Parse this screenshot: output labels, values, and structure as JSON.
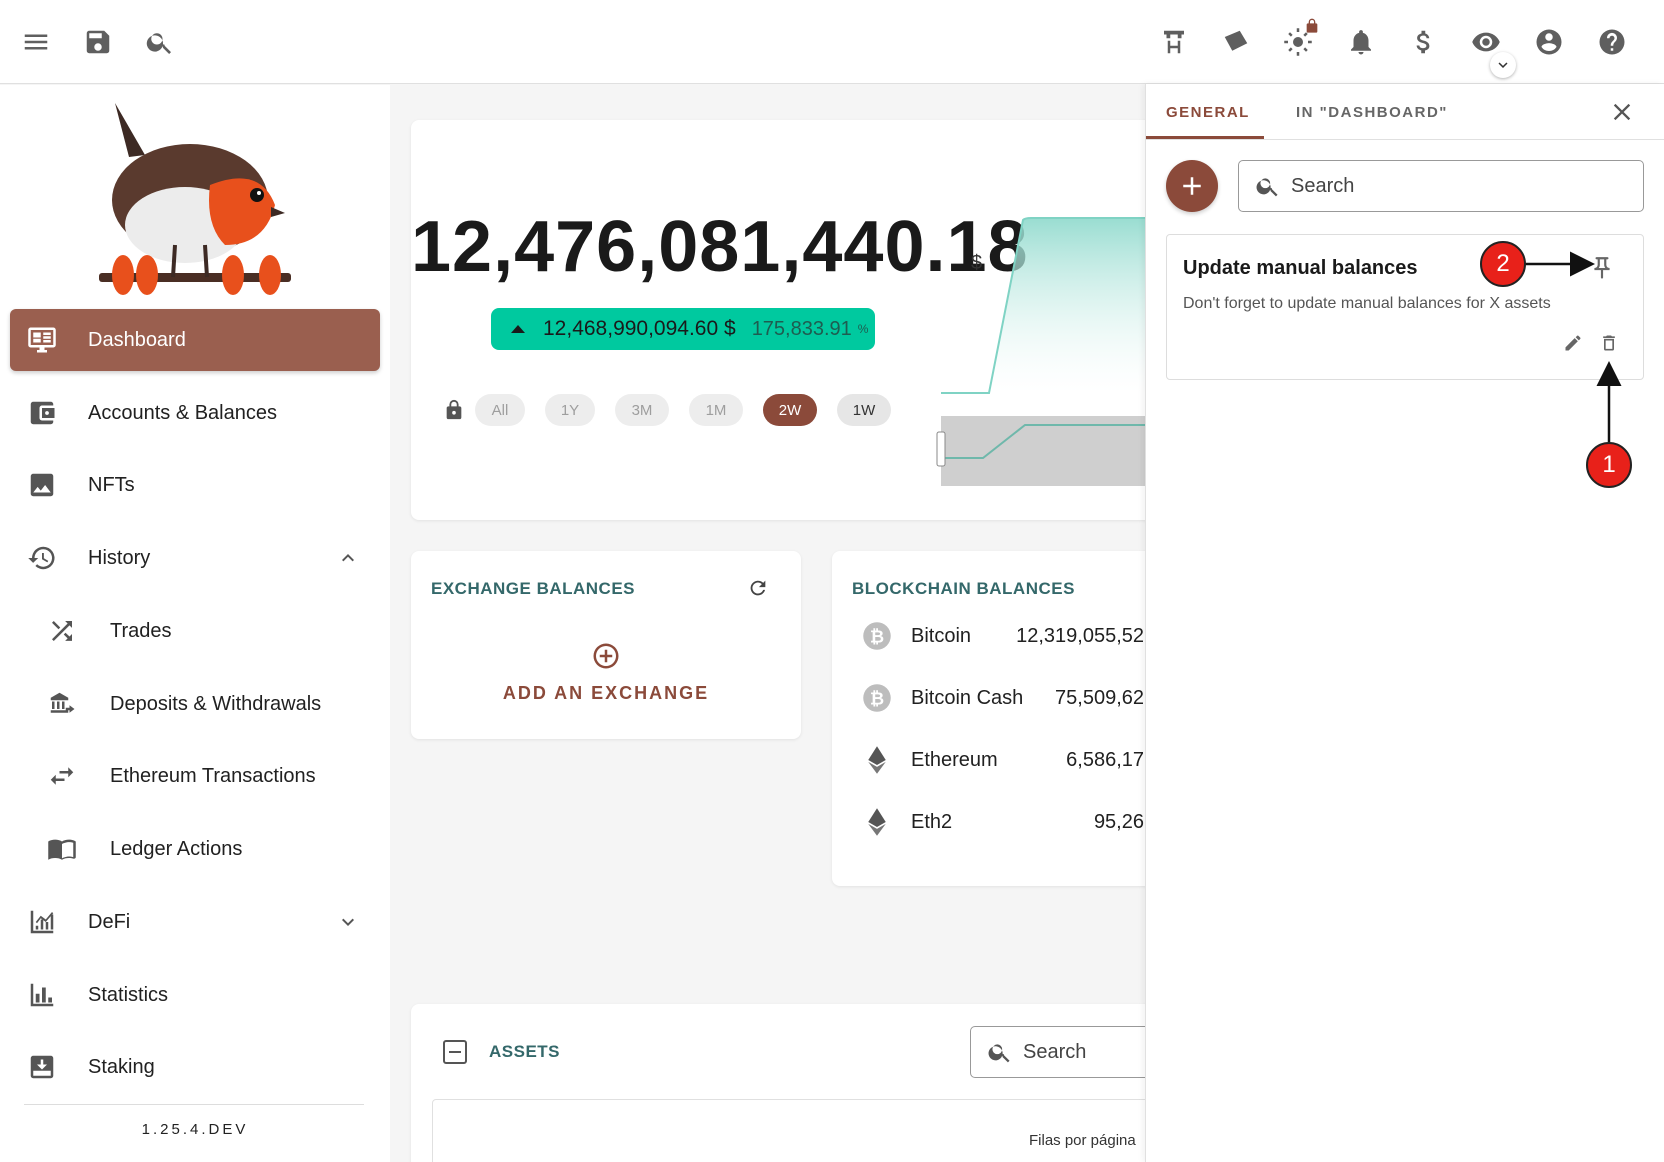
{
  "topbar": {
    "icons": [
      "menu-icon",
      "save-icon",
      "search-icon",
      "node-icon",
      "sync-icon",
      "theme-icon",
      "notification-icon",
      "currency-icon",
      "privacy-icon",
      "account-icon",
      "help-icon"
    ]
  },
  "sidebar": {
    "items": [
      {
        "label": "Dashboard",
        "icon": "dashboard-icon",
        "active": true
      },
      {
        "label": "Accounts & Balances",
        "icon": "wallet-icon"
      },
      {
        "label": "NFTs",
        "icon": "image-icon"
      },
      {
        "label": "History",
        "icon": "history-icon",
        "expanded": true
      },
      {
        "label": "Trades",
        "icon": "shuffle-icon"
      },
      {
        "label": "Deposits & Withdrawals",
        "icon": "bank-transfer-icon"
      },
      {
        "label": "Ethereum Transactions",
        "icon": "swap-icon"
      },
      {
        "label": "Ledger Actions",
        "icon": "book-icon"
      },
      {
        "label": "DeFi",
        "icon": "chart-line-icon"
      },
      {
        "label": "Statistics",
        "icon": "bar-chart-icon"
      },
      {
        "label": "Staking",
        "icon": "download-box-icon"
      }
    ],
    "version": "1.25.4.DEV"
  },
  "net_worth": {
    "value": "12,476,081,440.18",
    "currency": "$",
    "change_value": "12,468,990,094.60 $",
    "change_percent": "175,833.91",
    "percent_sign": "%",
    "periods": [
      "All",
      "1Y",
      "3M",
      "1M",
      "2W",
      "1W"
    ],
    "selected_period": "2W"
  },
  "exchange_balances": {
    "title": "EXCHANGE BALANCES",
    "add_label": "ADD AN EXCHANGE"
  },
  "blockchain_balances": {
    "title": "BLOCKCHAIN BALANCES",
    "rows": [
      {
        "name": "Bitcoin",
        "amount": "12,319,055,52",
        "icon": "bitcoin-icon"
      },
      {
        "name": "Bitcoin Cash",
        "amount": "75,509,62",
        "icon": "bitcoin-cash-icon"
      },
      {
        "name": "Ethereum",
        "amount": "6,586,17",
        "icon": "ethereum-icon"
      },
      {
        "name": "Eth2",
        "amount": "95,26",
        "icon": "ethereum-icon"
      }
    ]
  },
  "assets": {
    "title": "ASSETS",
    "search_placeholder": "Search",
    "rows_per_page": "Filas por página"
  },
  "panel": {
    "tabs": [
      "GENERAL",
      "IN \"DASHBOARD\""
    ],
    "active_tab": "GENERAL",
    "search_placeholder": "Search",
    "reminder": {
      "title": "Update manual balances",
      "description": "Don't forget to update manual balances for X assets"
    },
    "annotations": [
      "1",
      "2"
    ]
  },
  "colors": {
    "accent": "#8b4a3a",
    "teal": "#34686a",
    "positive": "#00c99f",
    "annotation": "#e8211a"
  }
}
